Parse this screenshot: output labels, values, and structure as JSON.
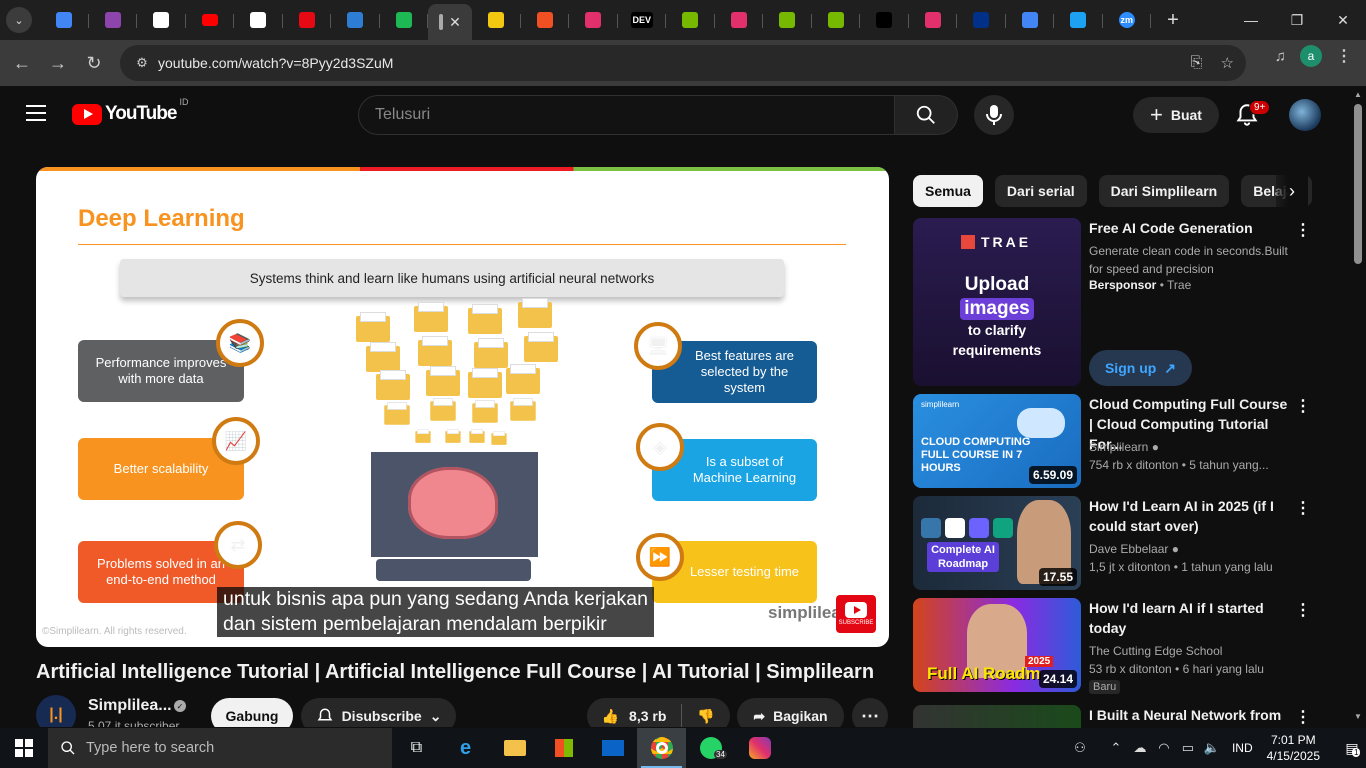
{
  "browser": {
    "tabs": [
      {
        "icon": "circle-icon",
        "color": "#4285f4"
      },
      {
        "icon": "sparkle-icon",
        "color": "#8e44ad"
      },
      {
        "icon": "chatgpt-icon",
        "color": "#ffffff"
      },
      {
        "icon": "youtube-icon",
        "color": "#ff0000"
      },
      {
        "icon": "openai-icon",
        "color": "#ffffff"
      },
      {
        "icon": "netflix-icon",
        "color": "#e50914"
      },
      {
        "icon": "store-icon",
        "color": "#2d7dd2"
      },
      {
        "icon": "spotify-icon",
        "color": "#1db954"
      },
      {
        "icon": "active-tab-icon",
        "color": "#cccccc"
      },
      {
        "icon": "bars-icon",
        "color": "#f2c811"
      },
      {
        "icon": "windows-icon",
        "color": "#f25022"
      },
      {
        "icon": "paint-icon",
        "color": "#e1306c"
      },
      {
        "icon": "dev-icon",
        "color": "#000000"
      },
      {
        "icon": "nvidia-icon",
        "color": "#76b900"
      },
      {
        "icon": "paint-icon",
        "color": "#e1306c"
      },
      {
        "icon": "nvidia-icon",
        "color": "#76b900"
      },
      {
        "icon": "nvidia-icon",
        "color": "#76b900"
      },
      {
        "icon": "tt-icon",
        "color": "#000000"
      },
      {
        "icon": "paint-icon",
        "color": "#e1306c"
      },
      {
        "icon": "paypal-icon",
        "color": "#003087"
      },
      {
        "icon": "translate-icon",
        "color": "#4285f4"
      },
      {
        "icon": "bird-icon",
        "color": "#1da1f2"
      },
      {
        "icon": "zm-icon",
        "color": "#2d8cff"
      }
    ],
    "dev_label": "DEV",
    "zm_label": "zm",
    "url": "youtube.com/watch?v=8Pyy2d3SZuM",
    "profile_initial": "a"
  },
  "youtube": {
    "logo_text": "YouTube",
    "country_code": "ID",
    "search_placeholder": "Telusuri",
    "create_label": "Buat",
    "notification_count": "9+"
  },
  "player": {
    "slide_title": "Deep Learning",
    "slide_banner": "Systems think and learn like humans using artificial neural networks",
    "left_items": [
      "Performance improves with more data",
      "Better scalability",
      "Problems solved in an end-to-end method"
    ],
    "right_items": [
      "Best features are selected by the system",
      "Is a subset of Machine Learning",
      "Lesser testing time"
    ],
    "caption_line1": "untuk bisnis apa pun yang sedang Anda kerjakan",
    "caption_line2": "dan sistem pembelajaran mendalam berpikir",
    "watermark": "©Simplilearn. All rights reserved.",
    "brand": "simplilear",
    "subscribe_badge": "SUBSCRIBE"
  },
  "video": {
    "title": "Artificial Intelligence Tutorial | Artificial Intelligence Full Course | AI Tutorial | Simplilearn",
    "channel_name": "Simplilea...",
    "channel_subs": "5,07 jt subscriber",
    "join_label": "Gabung",
    "subscribe_label": "Disubscribe",
    "like_count": "8,3 rb",
    "share_label": "Bagikan"
  },
  "filters": [
    "Semua",
    "Dari serial",
    "Dari Simplilearn",
    "Belajar"
  ],
  "ad": {
    "thumb_brand": "TRAE",
    "thumb_line1": "Upload",
    "thumb_line2": "images",
    "thumb_line3": "to clarify",
    "thumb_line4": "requirements",
    "title": "Free AI Code Generation",
    "description": "Generate clean code in seconds.Built for speed and precision",
    "sponsored_label": "Bersponsor",
    "sponsor": "• Trae",
    "cta": "Sign up"
  },
  "recommendations": [
    {
      "title": "Cloud Computing Full Course | Cloud Computing Tutorial For...",
      "channel": "Simplilearn",
      "verified": true,
      "meta": "754 rb x ditonton • 5 tahun yang...",
      "duration": "6.59.09",
      "thumb_text": "CLOUD COMPUTING FULL COURSE IN 7 HOURS",
      "thumb_brand": "simplilearn",
      "badge": ""
    },
    {
      "title": "How I'd Learn AI in 2025 (if I could start over)",
      "channel": "Dave Ebbelaar",
      "verified": true,
      "meta": "1,5 jt x ditonton • 1 tahun yang lalu",
      "duration": "17.55",
      "thumb_text": "Complete AI Roadmap",
      "badge": ""
    },
    {
      "title": "How I'd learn AI if I started today",
      "channel": "The Cutting Edge School",
      "verified": false,
      "meta": "53 rb x ditonton • 6 hari yang lalu",
      "duration": "24.14",
      "thumb_text": "Full AI Roadm",
      "thumb_year": "2025",
      "badge": "Baru"
    },
    {
      "title": "I Built a Neural Network from",
      "channel": "",
      "verified": false,
      "meta": "",
      "duration": "",
      "badge": ""
    }
  ],
  "taskbar": {
    "search_placeholder": "Type here to search",
    "language": "IND",
    "time": "7:01 PM",
    "date": "4/15/2025",
    "whatsapp_badge": "34",
    "notification_count": "1"
  }
}
